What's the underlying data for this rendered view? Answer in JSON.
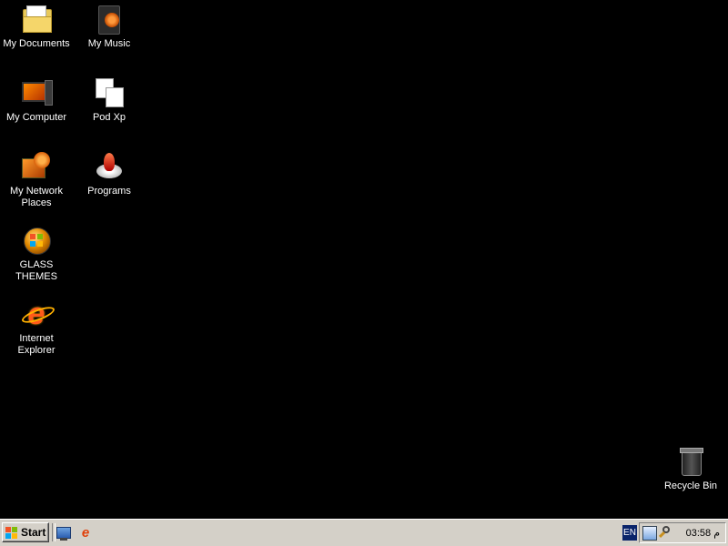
{
  "desktop": {
    "icons": [
      {
        "label": "My Documents",
        "icon": "my-documents-folder-icon"
      },
      {
        "label": "My Music",
        "icon": "my-music-icon"
      },
      {
        "label": "My Computer",
        "icon": "my-computer-icon"
      },
      {
        "label": "Pod Xp",
        "icon": "pod-xp-icon"
      },
      {
        "label": "My Network Places",
        "icon": "network-places-icon"
      },
      {
        "label": "Programs",
        "icon": "programs-icon"
      },
      {
        "label": "GLASS THEMES",
        "icon": "glass-themes-icon"
      },
      {
        "label": "Internet Explorer",
        "icon": "internet-explorer-icon"
      },
      {
        "label": "Recycle Bin",
        "icon": "recycle-bin-icon"
      }
    ],
    "background_color": "#000000"
  },
  "taskbar": {
    "start_label": "Start",
    "quick_launch": [
      {
        "icon": "show-desktop-icon"
      },
      {
        "icon": "internet-explorer-icon"
      }
    ],
    "language": "EN",
    "tray_icons": [
      "network-icon",
      "search-icon"
    ],
    "clock": "03:58 م"
  }
}
